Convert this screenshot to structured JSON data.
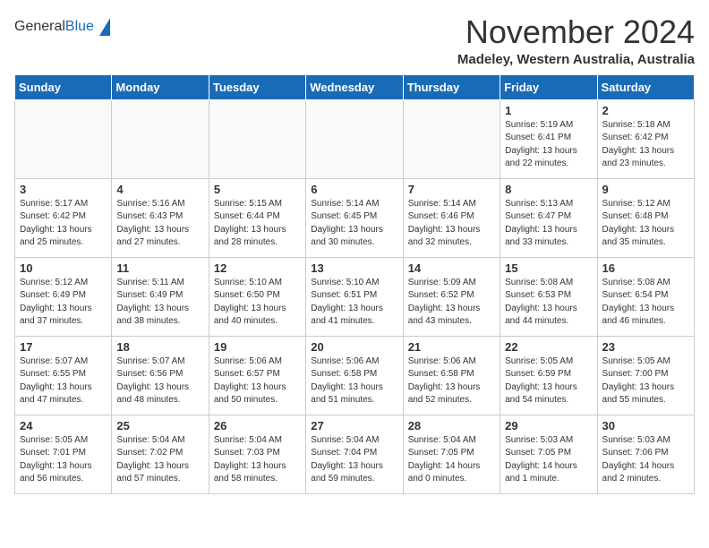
{
  "header": {
    "logo_general": "General",
    "logo_blue": "Blue",
    "month_title": "November 2024",
    "location": "Madeley, Western Australia, Australia"
  },
  "weekdays": [
    "Sunday",
    "Monday",
    "Tuesday",
    "Wednesday",
    "Thursday",
    "Friday",
    "Saturday"
  ],
  "weeks": [
    [
      {
        "day": "",
        "info": ""
      },
      {
        "day": "",
        "info": ""
      },
      {
        "day": "",
        "info": ""
      },
      {
        "day": "",
        "info": ""
      },
      {
        "day": "",
        "info": ""
      },
      {
        "day": "1",
        "info": "Sunrise: 5:19 AM\nSunset: 6:41 PM\nDaylight: 13 hours\nand 22 minutes."
      },
      {
        "day": "2",
        "info": "Sunrise: 5:18 AM\nSunset: 6:42 PM\nDaylight: 13 hours\nand 23 minutes."
      }
    ],
    [
      {
        "day": "3",
        "info": "Sunrise: 5:17 AM\nSunset: 6:42 PM\nDaylight: 13 hours\nand 25 minutes."
      },
      {
        "day": "4",
        "info": "Sunrise: 5:16 AM\nSunset: 6:43 PM\nDaylight: 13 hours\nand 27 minutes."
      },
      {
        "day": "5",
        "info": "Sunrise: 5:15 AM\nSunset: 6:44 PM\nDaylight: 13 hours\nand 28 minutes."
      },
      {
        "day": "6",
        "info": "Sunrise: 5:14 AM\nSunset: 6:45 PM\nDaylight: 13 hours\nand 30 minutes."
      },
      {
        "day": "7",
        "info": "Sunrise: 5:14 AM\nSunset: 6:46 PM\nDaylight: 13 hours\nand 32 minutes."
      },
      {
        "day": "8",
        "info": "Sunrise: 5:13 AM\nSunset: 6:47 PM\nDaylight: 13 hours\nand 33 minutes."
      },
      {
        "day": "9",
        "info": "Sunrise: 5:12 AM\nSunset: 6:48 PM\nDaylight: 13 hours\nand 35 minutes."
      }
    ],
    [
      {
        "day": "10",
        "info": "Sunrise: 5:12 AM\nSunset: 6:49 PM\nDaylight: 13 hours\nand 37 minutes."
      },
      {
        "day": "11",
        "info": "Sunrise: 5:11 AM\nSunset: 6:49 PM\nDaylight: 13 hours\nand 38 minutes."
      },
      {
        "day": "12",
        "info": "Sunrise: 5:10 AM\nSunset: 6:50 PM\nDaylight: 13 hours\nand 40 minutes."
      },
      {
        "day": "13",
        "info": "Sunrise: 5:10 AM\nSunset: 6:51 PM\nDaylight: 13 hours\nand 41 minutes."
      },
      {
        "day": "14",
        "info": "Sunrise: 5:09 AM\nSunset: 6:52 PM\nDaylight: 13 hours\nand 43 minutes."
      },
      {
        "day": "15",
        "info": "Sunrise: 5:08 AM\nSunset: 6:53 PM\nDaylight: 13 hours\nand 44 minutes."
      },
      {
        "day": "16",
        "info": "Sunrise: 5:08 AM\nSunset: 6:54 PM\nDaylight: 13 hours\nand 46 minutes."
      }
    ],
    [
      {
        "day": "17",
        "info": "Sunrise: 5:07 AM\nSunset: 6:55 PM\nDaylight: 13 hours\nand 47 minutes."
      },
      {
        "day": "18",
        "info": "Sunrise: 5:07 AM\nSunset: 6:56 PM\nDaylight: 13 hours\nand 48 minutes."
      },
      {
        "day": "19",
        "info": "Sunrise: 5:06 AM\nSunset: 6:57 PM\nDaylight: 13 hours\nand 50 minutes."
      },
      {
        "day": "20",
        "info": "Sunrise: 5:06 AM\nSunset: 6:58 PM\nDaylight: 13 hours\nand 51 minutes."
      },
      {
        "day": "21",
        "info": "Sunrise: 5:06 AM\nSunset: 6:58 PM\nDaylight: 13 hours\nand 52 minutes."
      },
      {
        "day": "22",
        "info": "Sunrise: 5:05 AM\nSunset: 6:59 PM\nDaylight: 13 hours\nand 54 minutes."
      },
      {
        "day": "23",
        "info": "Sunrise: 5:05 AM\nSunset: 7:00 PM\nDaylight: 13 hours\nand 55 minutes."
      }
    ],
    [
      {
        "day": "24",
        "info": "Sunrise: 5:05 AM\nSunset: 7:01 PM\nDaylight: 13 hours\nand 56 minutes."
      },
      {
        "day": "25",
        "info": "Sunrise: 5:04 AM\nSunset: 7:02 PM\nDaylight: 13 hours\nand 57 minutes."
      },
      {
        "day": "26",
        "info": "Sunrise: 5:04 AM\nSunset: 7:03 PM\nDaylight: 13 hours\nand 58 minutes."
      },
      {
        "day": "27",
        "info": "Sunrise: 5:04 AM\nSunset: 7:04 PM\nDaylight: 13 hours\nand 59 minutes."
      },
      {
        "day": "28",
        "info": "Sunrise: 5:04 AM\nSunset: 7:05 PM\nDaylight: 14 hours\nand 0 minutes."
      },
      {
        "day": "29",
        "info": "Sunrise: 5:03 AM\nSunset: 7:05 PM\nDaylight: 14 hours\nand 1 minute."
      },
      {
        "day": "30",
        "info": "Sunrise: 5:03 AM\nSunset: 7:06 PM\nDaylight: 14 hours\nand 2 minutes."
      }
    ]
  ]
}
